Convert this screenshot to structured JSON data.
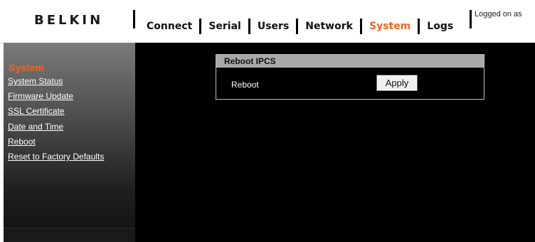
{
  "header": {
    "logo": "BELKIN",
    "nav": [
      {
        "label": "Connect",
        "active": false
      },
      {
        "label": "Serial",
        "active": false
      },
      {
        "label": "Users",
        "active": false
      },
      {
        "label": "Network",
        "active": false
      },
      {
        "label": "System",
        "active": true
      },
      {
        "label": "Logs",
        "active": false
      }
    ],
    "logged_on": "Logged on as"
  },
  "sidebar": {
    "title": "System",
    "links": [
      {
        "label": "System Status"
      },
      {
        "label": "Firmware Update"
      },
      {
        "label": "SSL Certificate"
      },
      {
        "label": "Date and Time"
      },
      {
        "label": "Reboot"
      },
      {
        "label": "Reset to Factory Defaults"
      }
    ]
  },
  "panel": {
    "title": "Reboot IPCS",
    "row_label": "Reboot",
    "apply_label": "Apply"
  },
  "colors": {
    "accent": "#f26522",
    "background": "#000000",
    "panel_header": "#a9a9a9"
  }
}
